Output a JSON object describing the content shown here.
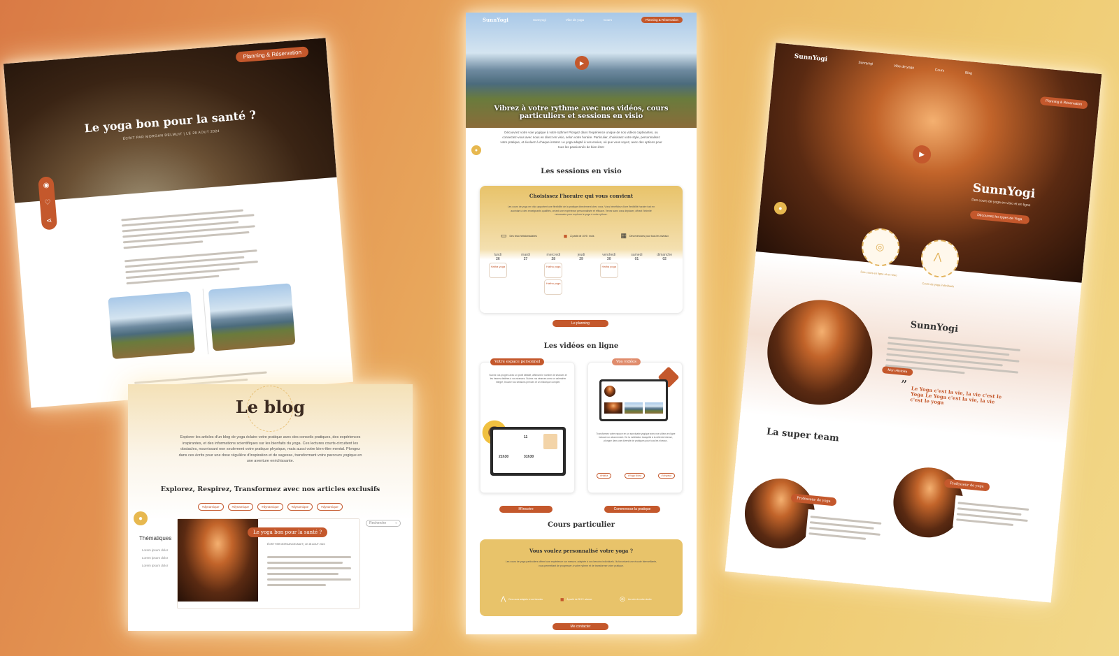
{
  "blog_article": {
    "cta": "Planning & Réservation",
    "title": "Le yoga bon pour la santé ?",
    "byline": "ÉCRIT PAR MORGAN DELMUIT | LE 28 AOUT 2024",
    "icons": [
      "eye-icon",
      "heart-icon",
      "share-icon"
    ]
  },
  "blog_home": {
    "title": "Le blog",
    "intro": "Explorer les articles d'un blog de yoga éclaire votre pratique avec des conseils pratiques, des expériences inspirantes, et des informations scientifiques sur les bienfaits du yoga. Ces lectures courts-circuitent les obstacles, nourrissant non seulement votre pratique physique, mais aussi votre bien-être mental. Plongez dans ces écrits pour une dose régulière d'inspiration et de sagesse, transformant votre parcours yogique en une aventure enrichissante.",
    "subtitle": "Explorez, Respirez, Transformez avec nos articles exclusifs",
    "tags": [
      "#dynamique",
      "#dynamique",
      "#dynamique",
      "#dynamique",
      "#dynamique"
    ],
    "sidebar_title": "Thématiques",
    "sidebar_items": [
      "Lorem ipsum dolor",
      "Lorem ipsum dolor",
      "Lorem ipsum dolor"
    ],
    "search_placeholder": "Recherche",
    "post_title": "Le yoga bon pour la santé ?",
    "post_byline": "ÉCRIT PAR MORGAN DELMUIT | LE 28 AOUT 2024"
  },
  "center": {
    "logo": "SunnYogi",
    "nav": [
      "Sunnyogi",
      "Vibe de yoga",
      "Cours"
    ],
    "cta": "Planning & Réservation",
    "hero_title": "Vibrez à votre rythme avec nos vidéos, cours particuliers et sessions en visio",
    "intro": "Découvrez votre voie yogique à votre rythme! Plongez dans l'expérience unique de nos vidéos captivantes, ou connectez-vous avec nous en direct en visio, selon votre horaire. Particulier, choisissez votre style, personnalisez votre pratique, et évoluez à chaque instant. Le yoga adapté à vos envies, où que vous soyez, avec des options pour tous les passionnés de bien-être!",
    "sessions_title": "Les sessions en visio",
    "sessions_box_title": "Choisissez l'horaire qui vous convient",
    "sessions_box_text": "Les cours de yoga en visio apportent une flexibilité de la pratique directement chez vous. Vous bénéficiez d'une flexibilité horaire tout en accédant à des enseignants qualifiés, créant une expérience personnalisée et efficace. Venez sans vous déplacer, offrant l'intimité nécessaire pour explorer le yoga à votre rythme.",
    "features": [
      {
        "icon": "tv-icon",
        "label": "Des visio hebdomadaires"
      },
      {
        "icon": "bookmark-icon",
        "label": "À partir de 10 € / mois"
      },
      {
        "icon": "calendar-icon",
        "label": "Des exercices pour tous les niveaux"
      }
    ],
    "days": [
      "lundi",
      "mardi",
      "mercredi",
      "jeudi",
      "vendredi",
      "samedi",
      "dimanche"
    ],
    "dates": [
      "26",
      "27",
      "28",
      "29",
      "30",
      "01",
      "02"
    ],
    "slot_label": "Hatha yoga",
    "planning_button": "Le planning",
    "videos_title": "Les vidéos en ligne",
    "space_label": "Votre espace personnel",
    "videos_label": "Vos vidéos",
    "space_text": "Suivez vos progrès avec un profil détaillé, affichant le nombre de séances et les heures dédiées à vos séances. Suivez vos séances avec un calendrier intégré, trouvez vos sessions prévues et un historique complet.",
    "videos_text": "Transformez votre espace en un sanctuaire yogique avec nos vidéos en ligne incluant un abonnement. De la méditation tranquille à la détente intense, plongez dans une diversité de pratiques pour tous les niveaux.",
    "video_tags": [
      "#Hatha",
      "#Yoga Nidra",
      "#Vinyasa"
    ],
    "signup_button": "M'inscrire",
    "practice_button": "Commencez la pratique",
    "private_title": "Cours particulier",
    "private_box_title": "Vous voulez personnalisé votre yoga ?",
    "private_box_text": "Les cours de yoga particuliers offrent une expérience sur mesure, adaptée à vos besoins individuels. Ils favorisent une écoute bienveillante, vous permettant de progresser à votre rythme et de transformer votre pratique.",
    "private_features": [
      "Des cours adaptés à vos besoins",
      "À partir de 35 € / séance",
      "Au sein de notre studio"
    ],
    "contact_button": "Me contacter",
    "time": "11",
    "time_a": "21h30",
    "time_b": "31h30"
  },
  "right": {
    "logo": "SunnYogi",
    "nav": [
      "Sunnyogi",
      "Vibe de yoga",
      "Cours",
      "Blog"
    ],
    "cta": "Planning & Réservation",
    "hero_title": "SunnYogi",
    "hero_sub": "Des cours de yoga en visio et en ligne",
    "hero_button": "Découvrez les types de Yoga",
    "sun_labels": [
      "Des cours en ligne et en visio",
      "Cours de yoga individuels"
    ],
    "about_title": "SunnYogi",
    "about_button": "Mon Histoire",
    "quote": "Le Yoga c'est la vie, la vie c'est le Yoga Le Yoga c'est la vie, la vie c'est le yoga",
    "team_title": "La super team",
    "team_badge": "Professeur de yoga"
  },
  "colors": {
    "accent": "#c4582c",
    "gold": "#e8c36a",
    "bg_start": "#d97a45",
    "bg_end": "#f2d889"
  }
}
